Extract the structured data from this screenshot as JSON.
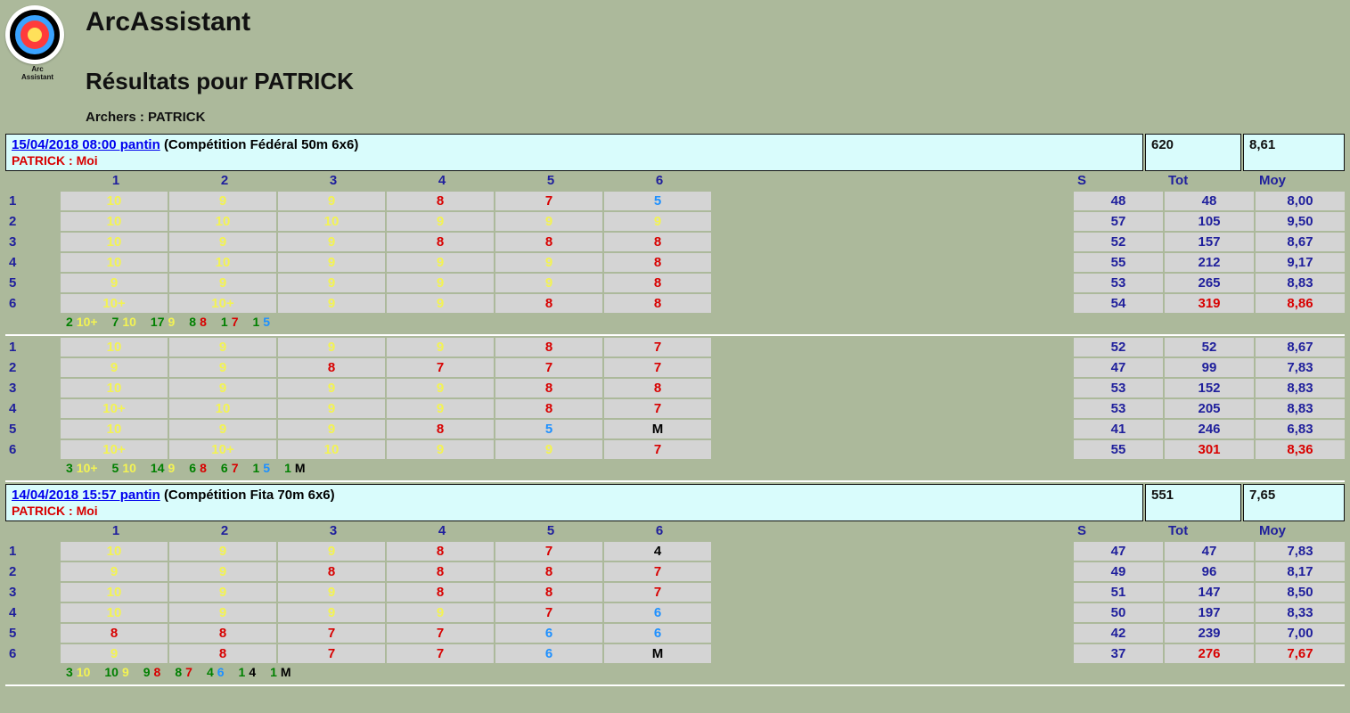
{
  "app_title": "ArcAssistant",
  "logo_text_top": "Arc",
  "logo_text_bottom": "Assistant",
  "page_title": "Résultats pour PATRICK",
  "archers_label": "Archers : PATRICK",
  "arrow_headers": [
    "1",
    "2",
    "3",
    "4",
    "5",
    "6"
  ],
  "sum_headers": {
    "s": "S",
    "tot": "Tot",
    "moy": "Moy"
  },
  "sessions": [
    {
      "datetime": "15/04/2018 08:00 pantin",
      "description": "(Compétition Fédéral 50m 6x6)",
      "archer_line": "PATRICK : Moi",
      "total": "620",
      "average": "8,61",
      "blocks": [
        {
          "rows": [
            {
              "arrows": [
                "10",
                "9",
                "9",
                "8",
                "7",
                "5"
              ],
              "s": "48",
              "tot": "48",
              "moy": "8,00",
              "final": false
            },
            {
              "arrows": [
                "10",
                "10",
                "10",
                "9",
                "9",
                "9"
              ],
              "s": "57",
              "tot": "105",
              "moy": "9,50",
              "final": false
            },
            {
              "arrows": [
                "10",
                "9",
                "9",
                "8",
                "8",
                "8"
              ],
              "s": "52",
              "tot": "157",
              "moy": "8,67",
              "final": false
            },
            {
              "arrows": [
                "10",
                "10",
                "9",
                "9",
                "9",
                "8"
              ],
              "s": "55",
              "tot": "212",
              "moy": "9,17",
              "final": false
            },
            {
              "arrows": [
                "9",
                "9",
                "9",
                "9",
                "9",
                "8"
              ],
              "s": "53",
              "tot": "265",
              "moy": "8,83",
              "final": false
            },
            {
              "arrows": [
                "10+",
                "10+",
                "9",
                "9",
                "8",
                "8"
              ],
              "s": "54",
              "tot": "319",
              "moy": "8,86",
              "final": true
            }
          ],
          "tally": [
            {
              "n": "2",
              "v": "10+",
              "c": "yellow"
            },
            {
              "n": "7",
              "v": "10",
              "c": "yellow"
            },
            {
              "n": "17",
              "v": "9",
              "c": "yellow"
            },
            {
              "n": "8",
              "v": "8",
              "c": "red"
            },
            {
              "n": "1",
              "v": "7",
              "c": "red"
            },
            {
              "n": "1",
              "v": "5",
              "c": "blue"
            }
          ]
        },
        {
          "rows": [
            {
              "arrows": [
                "10",
                "9",
                "9",
                "9",
                "8",
                "7"
              ],
              "s": "52",
              "tot": "52",
              "moy": "8,67",
              "final": false
            },
            {
              "arrows": [
                "9",
                "9",
                "8",
                "7",
                "7",
                "7"
              ],
              "s": "47",
              "tot": "99",
              "moy": "7,83",
              "final": false
            },
            {
              "arrows": [
                "10",
                "9",
                "9",
                "9",
                "8",
                "8"
              ],
              "s": "53",
              "tot": "152",
              "moy": "8,83",
              "final": false
            },
            {
              "arrows": [
                "10+",
                "10",
                "9",
                "9",
                "8",
                "7"
              ],
              "s": "53",
              "tot": "205",
              "moy": "8,83",
              "final": false
            },
            {
              "arrows": [
                "10",
                "9",
                "9",
                "8",
                "5",
                "M"
              ],
              "s": "41",
              "tot": "246",
              "moy": "6,83",
              "final": false
            },
            {
              "arrows": [
                "10+",
                "10+",
                "10",
                "9",
                "9",
                "7"
              ],
              "s": "55",
              "tot": "301",
              "moy": "8,36",
              "final": true
            }
          ],
          "tally": [
            {
              "n": "3",
              "v": "10+",
              "c": "yellow"
            },
            {
              "n": "5",
              "v": "10",
              "c": "yellow"
            },
            {
              "n": "14",
              "v": "9",
              "c": "yellow"
            },
            {
              "n": "6",
              "v": "8",
              "c": "red"
            },
            {
              "n": "6",
              "v": "7",
              "c": "red"
            },
            {
              "n": "1",
              "v": "5",
              "c": "blue"
            },
            {
              "n": "1",
              "v": "M",
              "c": "black"
            }
          ]
        }
      ]
    },
    {
      "datetime": "14/04/2018 15:57 pantin",
      "description": "(Compétition Fita 70m 6x6)",
      "archer_line": "PATRICK : Moi",
      "total": "551",
      "average": "7,65",
      "blocks": [
        {
          "rows": [
            {
              "arrows": [
                "10",
                "9",
                "9",
                "8",
                "7",
                "4"
              ],
              "s": "47",
              "tot": "47",
              "moy": "7,83",
              "final": false
            },
            {
              "arrows": [
                "9",
                "9",
                "8",
                "8",
                "8",
                "7"
              ],
              "s": "49",
              "tot": "96",
              "moy": "8,17",
              "final": false
            },
            {
              "arrows": [
                "10",
                "9",
                "9",
                "8",
                "8",
                "7"
              ],
              "s": "51",
              "tot": "147",
              "moy": "8,50",
              "final": false
            },
            {
              "arrows": [
                "10",
                "9",
                "9",
                "9",
                "7",
                "6"
              ],
              "s": "50",
              "tot": "197",
              "moy": "8,33",
              "final": false
            },
            {
              "arrows": [
                "8",
                "8",
                "7",
                "7",
                "6",
                "6"
              ],
              "s": "42",
              "tot": "239",
              "moy": "7,00",
              "final": false
            },
            {
              "arrows": [
                "9",
                "8",
                "7",
                "7",
                "6",
                "M"
              ],
              "s": "37",
              "tot": "276",
              "moy": "7,67",
              "final": true
            }
          ],
          "tally": [
            {
              "n": "3",
              "v": "10",
              "c": "yellow"
            },
            {
              "n": "10",
              "v": "9",
              "c": "yellow"
            },
            {
              "n": "9",
              "v": "8",
              "c": "red"
            },
            {
              "n": "8",
              "v": "7",
              "c": "red"
            },
            {
              "n": "4",
              "v": "6",
              "c": "blue"
            },
            {
              "n": "1",
              "v": "4",
              "c": "black"
            },
            {
              "n": "1",
              "v": "M",
              "c": "black"
            }
          ]
        }
      ]
    }
  ]
}
